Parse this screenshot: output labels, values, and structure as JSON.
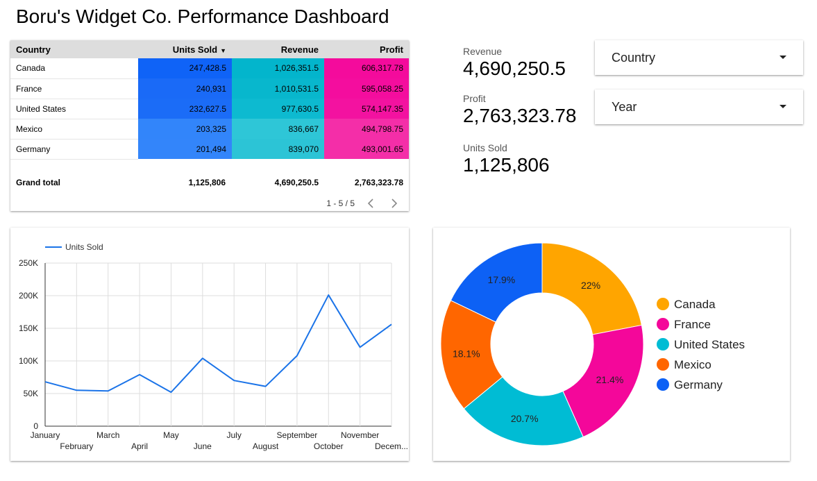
{
  "title": "Boru's Widget Co. Performance Dashboard",
  "table": {
    "headers": [
      "Country",
      "Units Sold",
      "Revenue",
      "Profit"
    ],
    "rows": [
      [
        "Canada",
        "247,428.5",
        "1,026,351.5",
        "606,317.78"
      ],
      [
        "France",
        "240,931",
        "1,010,531.5",
        "595,058.25"
      ],
      [
        "United States",
        "232,627.5",
        "977,630.5",
        "574,147.35"
      ],
      [
        "Mexico",
        "203,325",
        "836,667",
        "494,798.75"
      ],
      [
        "Germany",
        "201,494",
        "839,070",
        "493,001.65"
      ]
    ],
    "grand_total_label": "Grand total",
    "grand_totals": [
      "1,125,806",
      "4,690,250.5",
      "2,763,323.78"
    ],
    "pager": "1 - 5 / 5",
    "heat_colors": {
      "units": [
        "#0f63f7",
        "#1a6af7",
        "#1b6cf7",
        "#3285fa",
        "#3385fa"
      ],
      "revenue": [
        "#03b5cc",
        "#08b7cd",
        "#0dbad0",
        "#2ec6d7",
        "#2cc4d6"
      ],
      "profit": [
        "#f40b9c",
        "#f40d9e",
        "#f312a0",
        "#f42ea8",
        "#f42ea8"
      ]
    }
  },
  "scorecards": [
    {
      "label": "Revenue",
      "value": "4,690,250.5"
    },
    {
      "label": "Profit",
      "value": "2,763,323.78"
    },
    {
      "label": "Units Sold",
      "value": "1,125,806"
    }
  ],
  "filters": {
    "country": "Country",
    "year": "Year"
  },
  "chart_data": [
    {
      "type": "line",
      "legend": "Units Sold",
      "color": "#1a73e8",
      "x": [
        "January",
        "February",
        "March",
        "April",
        "May",
        "June",
        "July",
        "August",
        "September",
        "October",
        "November",
        "December"
      ],
      "x_tick_labels": [
        "January",
        "February",
        "March",
        "April",
        "May",
        "June",
        "July",
        "August",
        "September",
        "October",
        "November",
        "Decem..."
      ],
      "values": [
        68000,
        55000,
        54000,
        79000,
        52000,
        104000,
        70000,
        61000,
        108000,
        201000,
        121000,
        156000
      ],
      "ylim": [
        0,
        250000
      ],
      "y_ticks": [
        "0",
        "50K",
        "100K",
        "150K",
        "200K",
        "250K"
      ],
      "grid": true,
      "legend_position": "top-left"
    },
    {
      "type": "pie",
      "donut": true,
      "labels": [
        "Canada",
        "France",
        "United States",
        "Mexico",
        "Germany"
      ],
      "values": [
        22,
        21.4,
        20.7,
        18.1,
        17.9
      ],
      "value_labels": [
        "22%",
        "21.4%",
        "20.7%",
        "18.1%",
        "17.9%"
      ],
      "colors": [
        "#ffa500",
        "#f4079a",
        "#00bcd4",
        "#ff6600",
        "#0d61f5"
      ],
      "legend_position": "right"
    }
  ]
}
